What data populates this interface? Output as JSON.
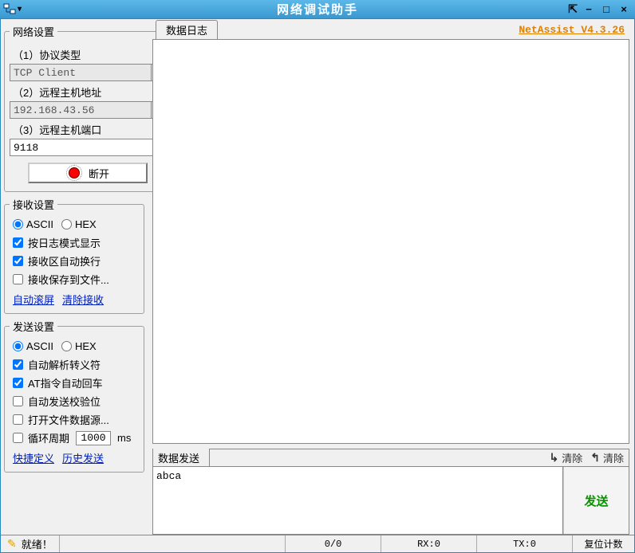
{
  "window": {
    "title": "网络调试助手"
  },
  "network": {
    "legend": "网络设置",
    "proto_label": "（1）协议类型",
    "proto_value": "TCP Client",
    "host_label": "（2）远程主机地址",
    "host_value": "192.168.43.56",
    "port_label": "（3）远程主机端口",
    "port_value": "9118",
    "disconnect": "断开"
  },
  "recv": {
    "legend": "接收设置",
    "ascii": "ASCII",
    "hex": "HEX",
    "opt1": "按日志模式显示",
    "opt2": "接收区自动换行",
    "opt3": "接收保存到文件...",
    "link1": "自动滚屏",
    "link2": "清除接收"
  },
  "send": {
    "legend": "发送设置",
    "ascii": "ASCII",
    "hex": "HEX",
    "opt1": "自动解析转义符",
    "opt2": "AT指令自动回车",
    "opt3": "自动发送校验位",
    "opt4": "打开文件数据源...",
    "opt5_pre": "循环周期",
    "opt5_val": "1000",
    "opt5_suf": "ms",
    "link1": "快捷定义",
    "link2": "历史发送"
  },
  "right": {
    "log_tab": "数据日志",
    "version": "NetAssist V4.3.26",
    "send_tab": "数据发送",
    "clear": "清除",
    "send_text": "abca",
    "send_btn": "发送"
  },
  "status": {
    "ready": "就绪！",
    "count": "0/0",
    "rx": "RX:0",
    "tx": "TX:0",
    "reset": "复位计数"
  }
}
